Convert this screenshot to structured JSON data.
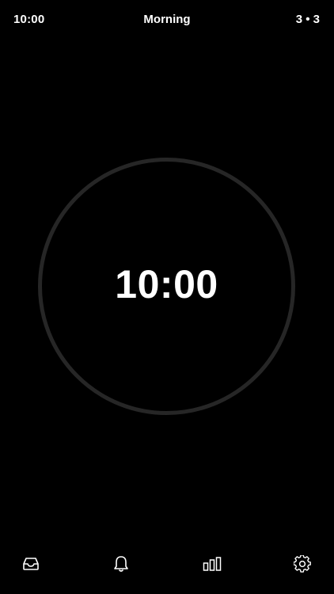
{
  "status_bar": {
    "time": "10:00",
    "title": "Morning",
    "counter": "3 • 3"
  },
  "timer": {
    "display": "10:00",
    "ring_color": "#262626",
    "progress": 0
  },
  "tab_bar": {
    "items": [
      {
        "icon": "inbox-icon"
      },
      {
        "icon": "bell-icon"
      },
      {
        "icon": "bar-chart-icon"
      },
      {
        "icon": "gear-icon"
      }
    ]
  },
  "colors": {
    "background": "#000000",
    "text": "#ffffff",
    "ring": "#262626"
  }
}
